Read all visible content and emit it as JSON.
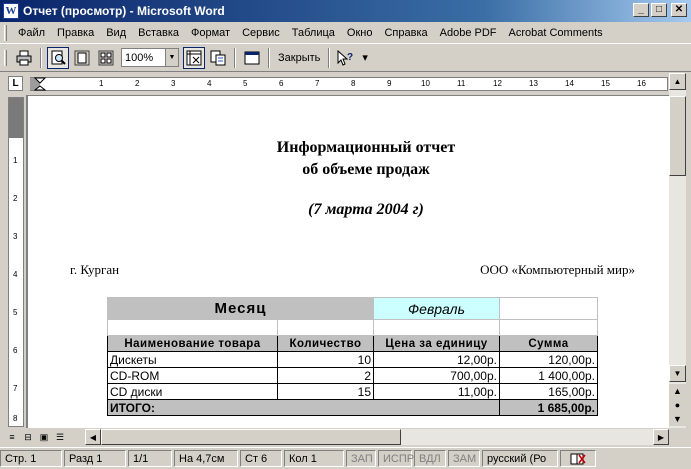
{
  "window": {
    "title": "Отчет (просмотр) - Microsoft Word",
    "app_icon": "W",
    "btn_min": "_",
    "btn_max": "□",
    "btn_close": "✕"
  },
  "menu": [
    {
      "label": "Файл"
    },
    {
      "label": "Правка"
    },
    {
      "label": "Вид"
    },
    {
      "label": "Вставка"
    },
    {
      "label": "Формат"
    },
    {
      "label": "Сервис"
    },
    {
      "label": "Таблица"
    },
    {
      "label": "Окно"
    },
    {
      "label": "Справка"
    },
    {
      "label": "Adobe PDF"
    },
    {
      "label": "Acrobat Comments"
    }
  ],
  "toolbar": {
    "zoom_value": "100%",
    "close_label": "Закрыть",
    "icons": [
      "printer-icon",
      "magnifier-icon",
      "one-page-icon",
      "multiple-pages-icon",
      "shrink-to-fit-icon",
      "full-screen-icon",
      "help-icon"
    ]
  },
  "ruler": {
    "corner": "L",
    "h_ticks": [
      "1",
      "2",
      "3",
      "4",
      "5",
      "6",
      "7",
      "8",
      "9",
      "10",
      "11",
      "12",
      "13",
      "14",
      "15",
      "16"
    ],
    "v_ticks": [
      "1",
      "2",
      "3",
      "4",
      "5",
      "6",
      "7",
      "8"
    ]
  },
  "document": {
    "title_line1": "Информационный отчет",
    "title_line2": "об объеме продаж",
    "date": "(7 марта 2004 г)",
    "city": "г. Курган",
    "company": "ООО «Компьютерный мир»",
    "table": {
      "month_label": "Месяц",
      "month_value": "Февраль",
      "headers": [
        "Наименование товара",
        "Количество",
        "Цена за единицу",
        "Сумма"
      ],
      "rows": [
        {
          "name": "Дискеты",
          "qty": "10",
          "price": "12,00р.",
          "sum": "120,00р."
        },
        {
          "name": "CD-ROM",
          "qty": "2",
          "price": "700,00р.",
          "sum": "1 400,00р."
        },
        {
          "name": "CD диски",
          "qty": "15",
          "price": "11,00р.",
          "sum": "165,00р."
        }
      ],
      "total_label": "ИТОГО:",
      "total_value": "1 685,00р."
    }
  },
  "status": {
    "page": "Стр. 1",
    "section": "Разд 1",
    "pages": "1/1",
    "at": "На 4,7см",
    "line": "Ст 6",
    "col": "Кол 1",
    "rec": "ЗАП",
    "trk": "ИСПР",
    "ext": "ВДЛ",
    "ovr": "ЗАМ",
    "lang": "русский (Ро"
  }
}
